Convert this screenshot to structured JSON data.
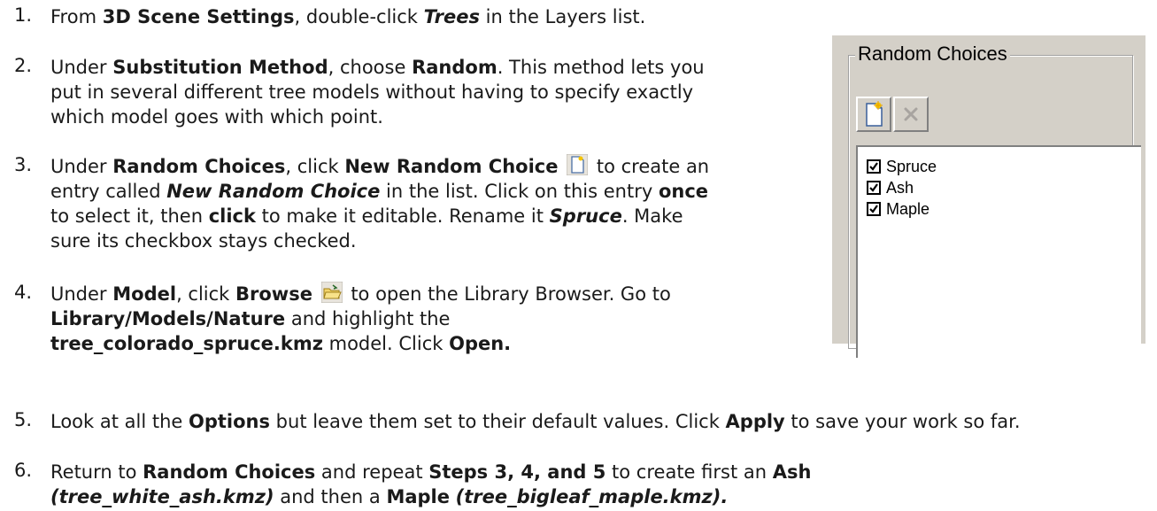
{
  "steps": [
    {
      "num": "1.",
      "l1": {
        "a": "From ",
        "b": "3D Scene Settings",
        "c": ", double-click ",
        "d": "Trees",
        "e": " in the Layers list."
      }
    },
    {
      "num": "2.",
      "l1": {
        "a": "Under ",
        "b": "Substitution Method",
        "c": ", choose ",
        "d": "Random",
        "e": ".  This method lets you"
      },
      "l2": "put in several different tree models without having to specify exactly",
      "l3": "which model goes with which point."
    },
    {
      "num": "3.",
      "l1": {
        "a": "Under ",
        "b": "Random Choices",
        "c": ", click ",
        "d": "New Random Choice",
        "e": " to create an"
      },
      "l2": {
        "a": "entry called ",
        "b": "New Random Choice",
        "c": " in the list.  Click on this entry ",
        "d": "once"
      },
      "l3": {
        "a": "to select it, then ",
        "b": "click",
        "c": " to make it editable. Rename it ",
        "d": "Spruce",
        "e": ".  Make"
      },
      "l4": "sure its checkbox stays checked."
    },
    {
      "num": "4.",
      "l1": {
        "a": "Under ",
        "b": "Model",
        "c": ", click ",
        "d": "Browse",
        "e": " to open the Library Browser.  Go to"
      },
      "l2": {
        "a": "Library/Models/Nature",
        "b": " and highlight the"
      },
      "l3": {
        "a": "tree_colorado_spruce.kmz",
        "b": " model.  Click ",
        "c": "Open."
      }
    },
    {
      "num": "5.",
      "l1": {
        "a": "Look at all the ",
        "b": "Options",
        "c": " but leave them set to their default values.  Click ",
        "d": "Apply",
        "e": " to save your work so far."
      }
    },
    {
      "num": "6.",
      "l1": {
        "a": "Return to ",
        "b": "Random Choices",
        "c": " and repeat ",
        "d": "Steps 3, 4, and 5",
        "e": " to create first an ",
        "f": "Ash"
      },
      "l2": {
        "a": "(tree_white_ash.kmz)",
        "b": " and then a ",
        "c": "Maple",
        "d": "(tree_bigleaf_maple.kmz)."
      }
    }
  ],
  "panel": {
    "legend": "Random Choices",
    "items": [
      "Spruce",
      "Ash",
      "Maple"
    ],
    "checked": [
      true,
      true,
      true
    ]
  },
  "icons": {
    "new": "new-document-icon",
    "delete": "delete-x-icon",
    "browse": "open-folder-icon"
  }
}
